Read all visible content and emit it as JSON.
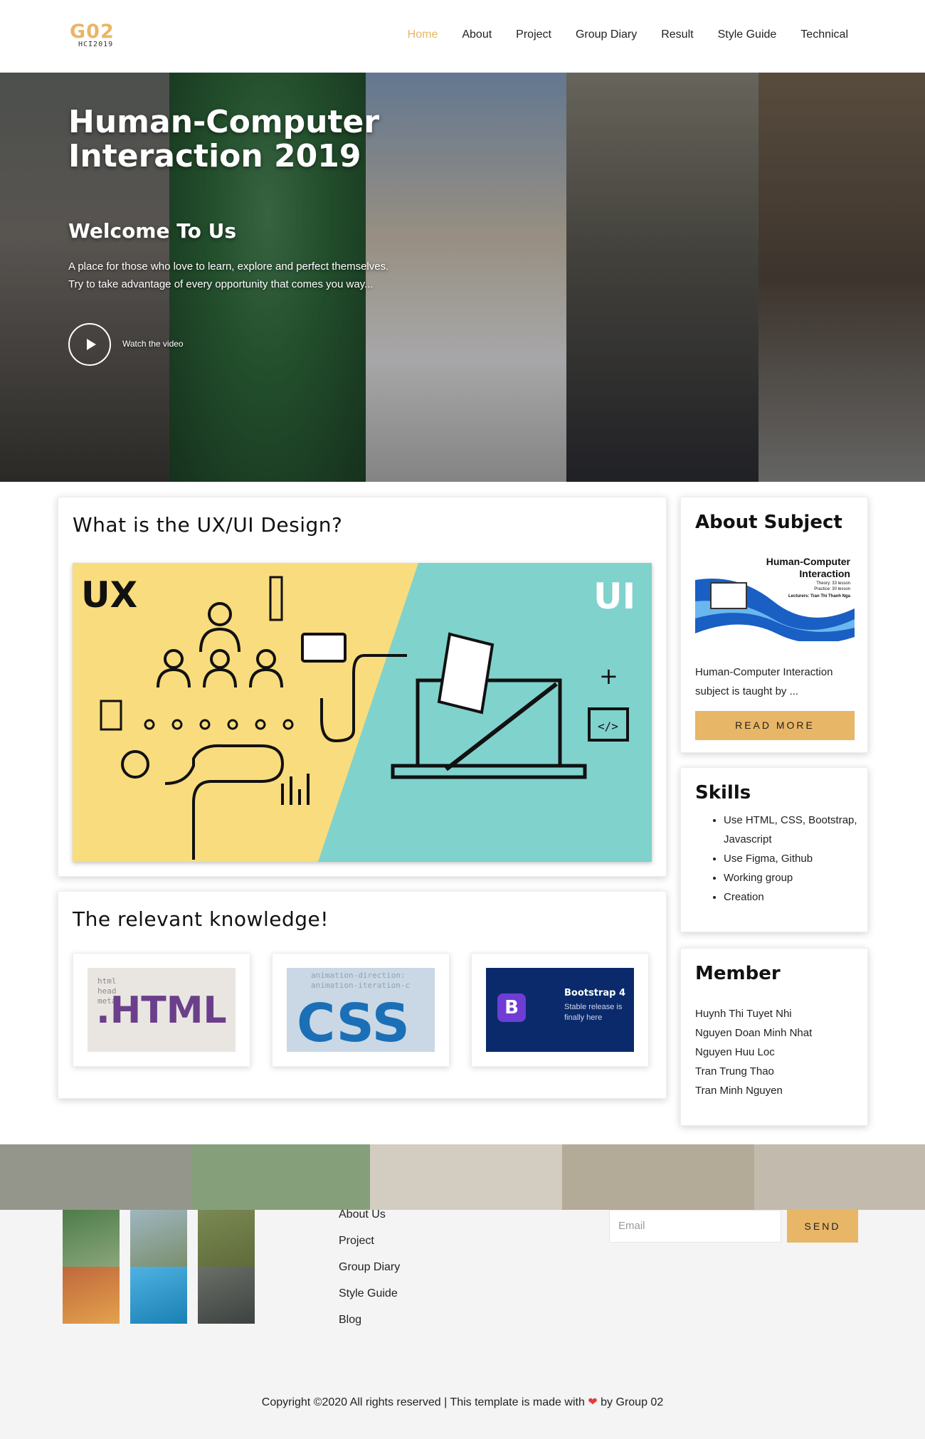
{
  "logo": {
    "main": "G02",
    "sub": "HCI2019"
  },
  "nav": {
    "items": [
      "Home",
      "About",
      "Project",
      "Group Diary",
      "Result",
      "Style Guide",
      "Technical"
    ],
    "active": "Home"
  },
  "hero": {
    "title": "Human-Computer Interaction 2019",
    "subtitle": "Welcome To Us",
    "text": "A place for those who love to learn, explore and perfect themselves. Try to take advantage of every opportunity that comes you way...",
    "watch_label": "Watch the video"
  },
  "main": {
    "ux_title": "What is the UX/UI Design?",
    "ux_image": {
      "left_label": "UX",
      "right_label": "UI"
    },
    "knowledge_title": "The relevant knowledge!",
    "knowledge_tiles": [
      {
        "label": ".HTML"
      },
      {
        "label": "CSS"
      },
      {
        "label": "Bootstrap 4",
        "sub": "Stable release is finally here"
      }
    ]
  },
  "sidebar": {
    "about": {
      "title": "About Subject",
      "image_title": "Human-Computer Interaction",
      "image_lines": [
        "Theory: 33 lesson",
        "Practice: 30 lesson",
        "Lecturers: Tran Thi Thanh Nga"
      ],
      "text": "Human-Computer Interaction subject is taught by ...",
      "button": "READ MORE"
    },
    "skills": {
      "title": "Skills",
      "items": [
        "Use HTML, CSS, Bootstrap, Javascript",
        "Use Figma, Github",
        "Working group",
        "Creation"
      ]
    },
    "member": {
      "title": "Member",
      "items": [
        "Huynh Thi Tuyet Nhi",
        "Nguyen Doan Minh Nhat",
        "Nguyen Huu Loc",
        "Tran Trung Thao",
        "Tran Minh Nguyen"
      ]
    }
  },
  "footer": {
    "links": [
      "About Us",
      "Project",
      "Group Diary",
      "Style Guide",
      "Blog"
    ],
    "email_placeholder": "Email",
    "send_label": "SEND",
    "copyright_before": "Copyright ©2020 All rights reserved | This template is made with",
    "copyright_after": "by Group 02"
  },
  "colors": {
    "accent": "#e8b667",
    "ux_yellow": "#f9dc7d",
    "ui_teal": "#80d2cd",
    "heart": "#e03c3c"
  }
}
